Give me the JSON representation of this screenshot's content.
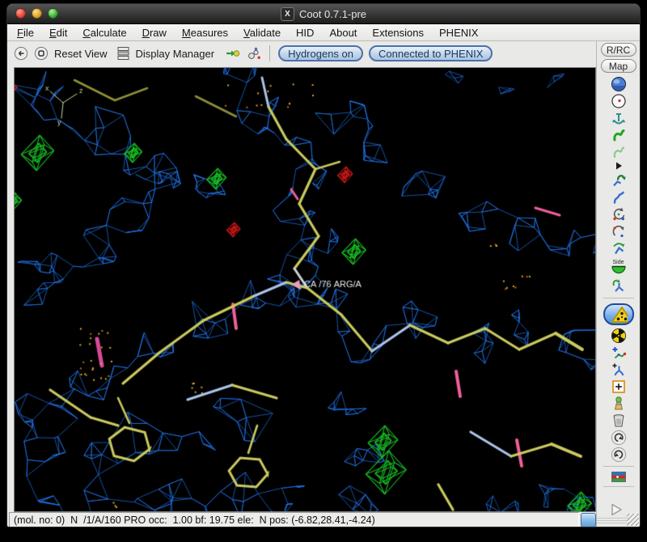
{
  "window": {
    "title": "Coot 0.7.1-pre",
    "x11_badge": "X"
  },
  "menu_bar": {
    "items": [
      {
        "label": "File",
        "mnemonic": 0
      },
      {
        "label": "Edit",
        "mnemonic": 0
      },
      {
        "label": "Calculate",
        "mnemonic": 0
      },
      {
        "label": "Draw",
        "mnemonic": 0
      },
      {
        "label": "Measures",
        "mnemonic": 0
      },
      {
        "label": "Validate",
        "mnemonic": 0
      },
      {
        "label": "HID",
        "mnemonic": -1
      },
      {
        "label": "About",
        "mnemonic": -1
      },
      {
        "label": "Extensions",
        "mnemonic": -1
      },
      {
        "label": "PHENIX",
        "mnemonic": -1
      }
    ]
  },
  "toolbar": {
    "reset_view_label": "Reset View",
    "display_manager_label": "Display Manager",
    "hydrogens_button": "Hydrogens on",
    "phenix_button": "Connected to PHENIX",
    "icons": [
      "back-icon",
      "recenter-target-icon",
      "display-manager-icon",
      "go-to-atom-icon",
      "go-to-ligand-icon"
    ]
  },
  "right_panel": {
    "rrc_button": "R/RC",
    "map_button": "Map",
    "side_label": "Side",
    "icons": [
      "sphere-view-icon",
      "recentre-icon",
      "rigid-body-fit-icon",
      "real-space-refine-icon",
      "regularize-icon",
      "expander-arrow-icon",
      "auto-fit-rotamer-icon",
      "rotamer-icon",
      "edit-chi-angles-icon",
      "torsion-general-icon",
      "flip-peptide-icon",
      "side-chain-flip-icon",
      "jiggle-fit-icon",
      "active-tool-icon",
      "radiation-icon",
      "add-terminal-residue-icon",
      "add-alt-conf-icon",
      "place-atom-icon",
      "mutate-icon",
      "delete-icon",
      "undo-icon",
      "redo-icon",
      "flag-icon",
      "play-icon"
    ]
  },
  "canvas": {
    "atom_label": "CA /76 ARG/A",
    "axes": {
      "x": "x",
      "y": "y",
      "z": "z"
    },
    "colors": {
      "background": "#000000",
      "density_map": "#2277ee",
      "diff_map_positive": "#19c525",
      "diff_map_negative": "#cc1818",
      "carbon_bonds": "#c9c95e",
      "light_bonds": "#aac3ea",
      "highlight_pink": "#f05f9a",
      "water_dots": "#d8a826",
      "axes": "#c6d79b",
      "label_text": "#e8e8e8"
    }
  },
  "status_bar": {
    "text": "(mol. no: 0)  N  /1/A/160 PRO occ:  1.00 bf: 19.75 ele:  N pos: (-6.82,28.41,-4.24)"
  }
}
